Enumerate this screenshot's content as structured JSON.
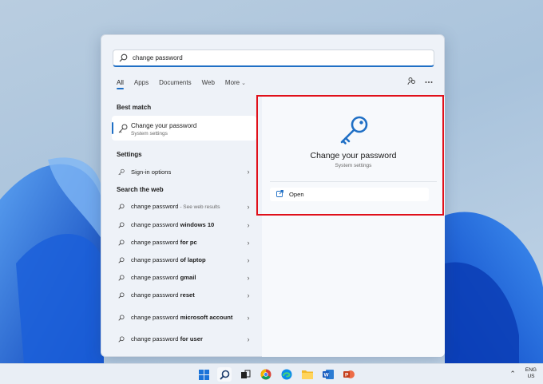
{
  "search": {
    "value": "change password"
  },
  "filters": [
    {
      "label": "All"
    },
    {
      "label": "Apps"
    },
    {
      "label": "Documents"
    },
    {
      "label": "Web"
    },
    {
      "label": "More"
    }
  ],
  "sections": {
    "best_match": "Best match",
    "settings": "Settings",
    "search_web": "Search the web"
  },
  "best_match": {
    "title": "Change your password",
    "subtitle": "System settings"
  },
  "settings_item": {
    "label": "Sign-in options"
  },
  "web_results": [
    {
      "prefix": "change password",
      "bold": "",
      "suffix": " - See web results"
    },
    {
      "prefix": "change password ",
      "bold": "windows 10",
      "suffix": ""
    },
    {
      "prefix": "change password ",
      "bold": "for pc",
      "suffix": ""
    },
    {
      "prefix": "change password ",
      "bold": "of laptop",
      "suffix": ""
    },
    {
      "prefix": "change password ",
      "bold": "gmail",
      "suffix": ""
    },
    {
      "prefix": "change password ",
      "bold": "reset",
      "suffix": ""
    },
    {
      "prefix": "change password ",
      "bold": "microsoft account",
      "suffix": ""
    },
    {
      "prefix": "change password ",
      "bold": "for user",
      "suffix": ""
    }
  ],
  "preview": {
    "title": "Change your password",
    "subtitle": "System settings",
    "action": "Open"
  },
  "taskbar": {
    "apps": [
      "windows-start-icon",
      "search-icon",
      "task-view-icon",
      "chrome-icon",
      "edge-icon",
      "file-explorer-icon",
      "word-icon",
      "powerpoint-icon"
    ],
    "lang_line1": "ENG",
    "lang_line2": "US"
  },
  "colors": {
    "accent": "#1f6fc5",
    "highlight": "#e0101a"
  }
}
